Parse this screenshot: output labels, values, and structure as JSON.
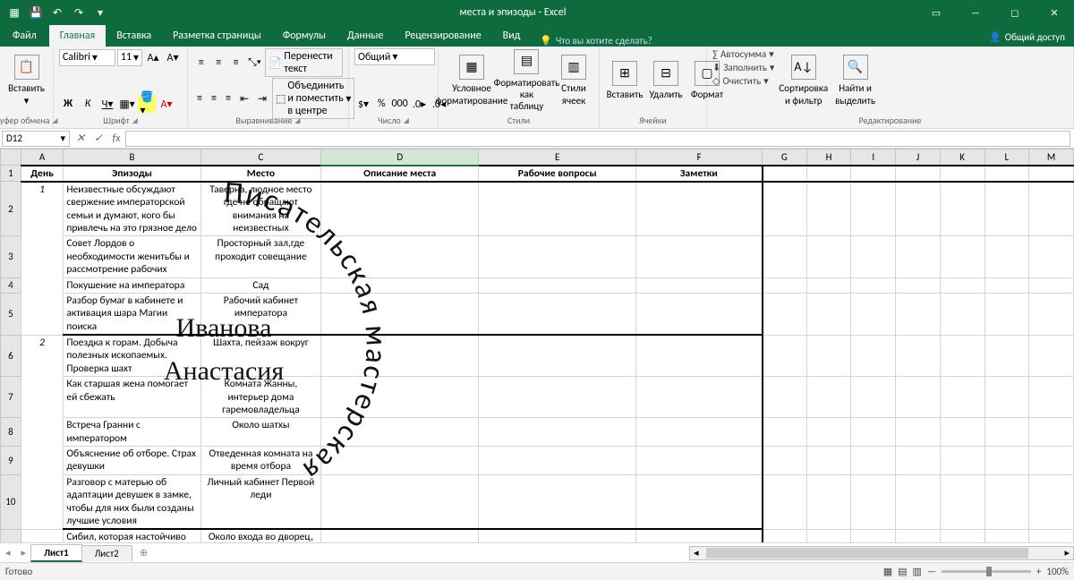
{
  "app": {
    "title": "места и эпизоды - Excel",
    "share": "Общий доступ",
    "tellme": "Что вы хотите сделать?"
  },
  "tabs": {
    "file": "Файл",
    "items": [
      "Главная",
      "Вставка",
      "Разметка страницы",
      "Формулы",
      "Данные",
      "Рецензирование",
      "Вид"
    ],
    "active_index": 0
  },
  "ribbon": {
    "clipboard": {
      "label": "Буфер обмена",
      "paste": "Вставить"
    },
    "font": {
      "label": "Шрифт",
      "name": "Calibri",
      "size": "11"
    },
    "alignment": {
      "label": "Выравнивание",
      "wrap": "Перенести текст",
      "merge": "Объединить и поместить в центре"
    },
    "number": {
      "label": "Число",
      "format": "Общий"
    },
    "styles": {
      "label": "Стили",
      "condfmt1": "Условное",
      "condfmt2": "форматирование",
      "table1": "Форматировать",
      "table2": "как таблицу",
      "cellstyle1": "Стили",
      "cellstyle2": "ячеек"
    },
    "cells": {
      "label": "Ячейки",
      "insert": "Вставить",
      "delete": "Удалить",
      "format": "Формат"
    },
    "editing": {
      "label": "Редактирование",
      "autosum": "Автосумма",
      "fill": "Заполнить",
      "clear": "Очистить",
      "sort1": "Сортировка",
      "sort2": "и фильтр",
      "find1": "Найти и",
      "find2": "выделить"
    }
  },
  "namebox": "D12",
  "col_headers": [
    "A",
    "B",
    "C",
    "D",
    "E",
    "F",
    "G",
    "H",
    "I",
    "J",
    "K",
    "L",
    "M"
  ],
  "row_headers": [
    "1",
    "2",
    "3",
    "4",
    "5",
    "6",
    "7",
    "8",
    "9",
    "10"
  ],
  "header_row": {
    "A": "День",
    "B": "Эпизоды",
    "C": "Место",
    "D": "Описание места",
    "E": "Рабочие вопросы",
    "F": "Заметки"
  },
  "data": {
    "r2": {
      "B": "Неизвестные обсуждают свержение императорской семьи и думают, кого бы привлечь на это грязное дело",
      "C": "Таверна, людное место где не обращают внимания на неизвестных"
    },
    "r3": {
      "A": "1",
      "B": "Совет Лордов о необходимости женитьбы и рассмотрение рабочих",
      "C": "Просторный зал,где проходит совещание"
    },
    "r4": {
      "B": "Покушение на императора",
      "C": "Сад"
    },
    "r5": {
      "B": "Разбор бумаг в кабинете и активация шара Магии поиска",
      "C": "Рабочий кабинет императора"
    },
    "r6": {
      "B": "Поездка к горам. Добыча полезных ископаемых. Проверка шахт",
      "C": "Шахта, пейзаж вокруг"
    },
    "r7": {
      "B": "Как старшая жена помогает ей сбежать",
      "C": "Комната Жанны, интерьер дома гаремовладельца"
    },
    "r8": {
      "A": "2",
      "B": "Встреча Гранни с императором",
      "C": "Около шатхы"
    },
    "r9": {
      "B": "Объяснение об отборе. Страх девушки",
      "C": "Отведенная комната на время отбора"
    },
    "r10": {
      "B": "Разговор с матерью об адаптации девушек в замке, чтобы для них были созданы лучшие условия",
      "C": "Личный кабинет Первой леди"
    },
    "r11": {
      "B": "Сибил, которая настойчиво добивается встречи с",
      "C": "Около входа во дворец, внутренний дворик"
    }
  },
  "sheets": {
    "tabs": [
      "Лист1",
      "Лист2"
    ],
    "active": 0,
    "add": "+"
  },
  "status": {
    "ready": "Готово",
    "zoom": "100%"
  },
  "watermark": {
    "ring": "Писательская мастерская",
    "line1": "Иванова",
    "line2": "Анастасия"
  }
}
